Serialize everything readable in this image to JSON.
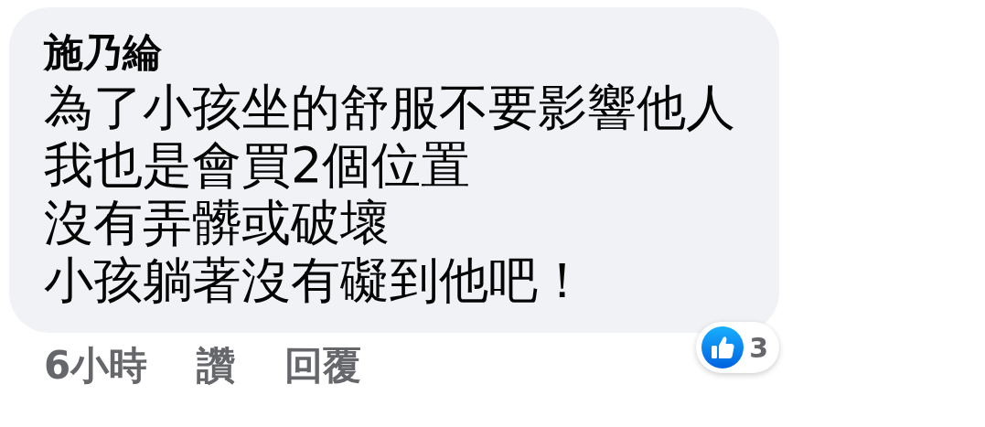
{
  "comment": {
    "author": "施乃綸",
    "lines": [
      "為了小孩坐的舒服不要影響他人",
      "我也是會買2個位置",
      "沒有弄髒或破壞",
      "小孩躺著沒有礙到他吧！"
    ],
    "reactions": {
      "count": "3"
    },
    "time": "6小時",
    "actions": [
      "讚",
      "回覆"
    ]
  }
}
